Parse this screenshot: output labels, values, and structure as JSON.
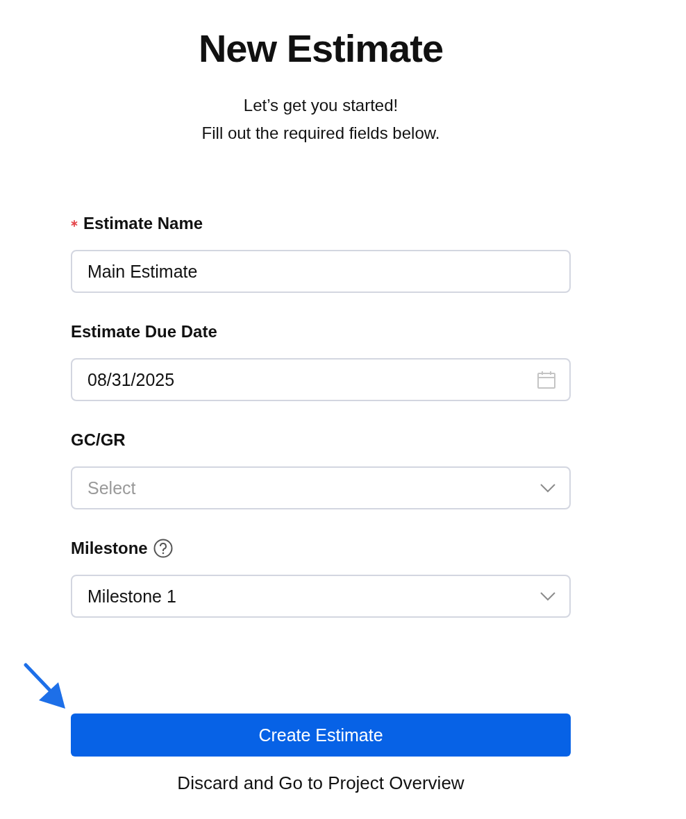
{
  "title": "New Estimate",
  "subtitle": [
    "Let’s get you started!",
    "Fill out the required fields below."
  ],
  "fields": [
    {
      "label": "Estimate Name",
      "kind": "text",
      "required": true,
      "help": false,
      "value": "Main Estimate"
    },
    {
      "label": "Estimate Due Date",
      "kind": "date",
      "required": false,
      "help": false,
      "value": "08/31/2025"
    },
    {
      "label": "GC/GR",
      "kind": "select",
      "required": false,
      "help": false,
      "placeholder": "Select"
    },
    {
      "label": "Milestone",
      "kind": "select",
      "required": false,
      "help": true,
      "value": "Milestone 1"
    }
  ],
  "primary_button": "Create Estimate",
  "secondary_link": "Discard and Go to Project Overview"
}
